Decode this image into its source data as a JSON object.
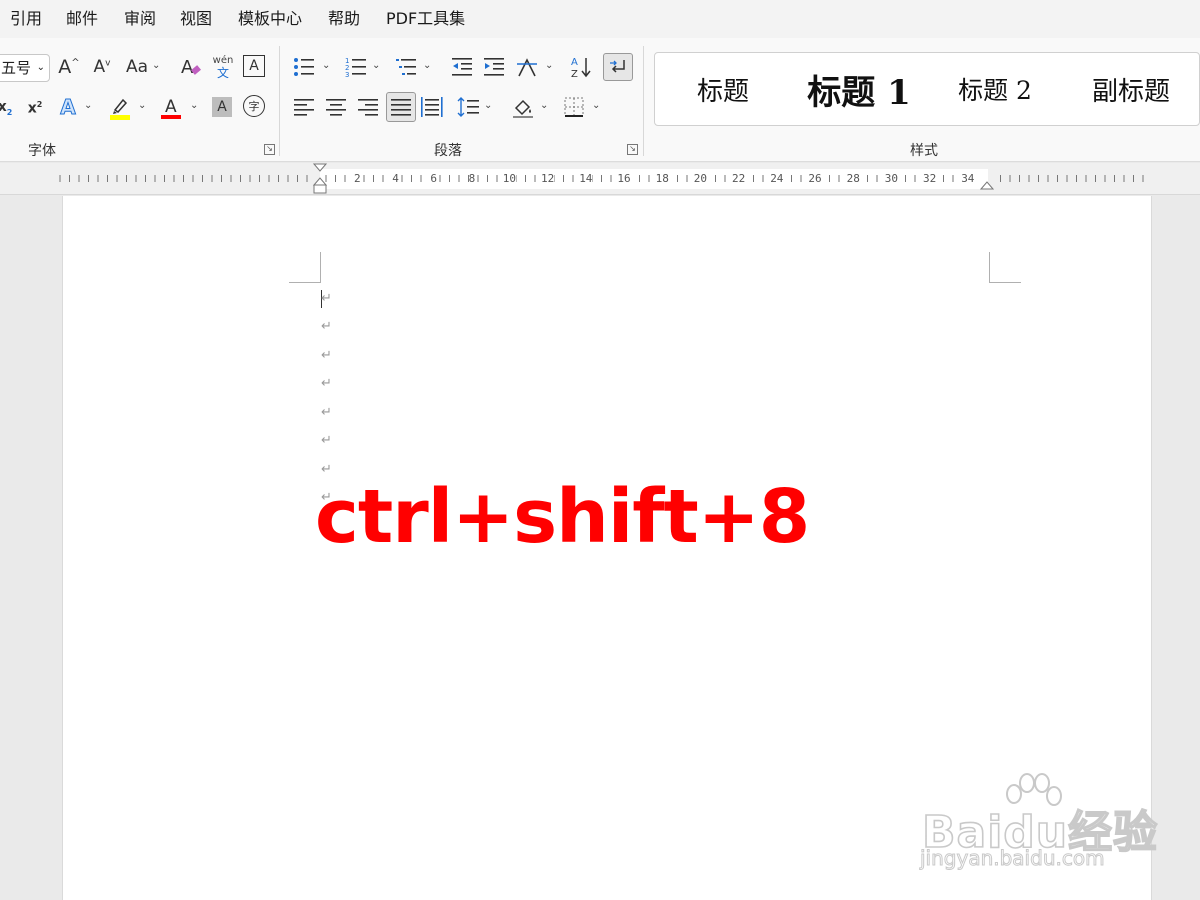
{
  "menu": [
    "引用",
    "邮件",
    "审阅",
    "视图",
    "模板中心",
    "帮助",
    "PDF工具集"
  ],
  "ribbon": {
    "font_group": {
      "label": "字体",
      "font_size": "五号",
      "phonetic_top": "wén",
      "phonetic_bottom": "文",
      "change_case": "Aa",
      "char_shading": "A",
      "enclose_char": "字",
      "grow_font": "A",
      "shrink_font": "A",
      "subscript": "x",
      "superscript": "x"
    },
    "paragraph_group": {
      "label": "段落"
    },
    "styles_group": {
      "label": "样式",
      "items": [
        "标题",
        "标题 1",
        "标题 2",
        "副标题"
      ]
    }
  },
  "ruler": {
    "numbers": [
      "2",
      "4",
      "6",
      "8",
      "10",
      "12",
      "14",
      "16",
      "18",
      "20",
      "22",
      "24",
      "26",
      "28",
      "30",
      "32",
      "34"
    ]
  },
  "document": {
    "paragraph_mark": "↵",
    "overlay_text": "ctrl+shift+8",
    "overlay_color": "#ff0000"
  },
  "watermark": {
    "logo_text": "Baidu经验",
    "url": "jingyan.baidu.com"
  },
  "colors": {
    "highlight": "#ffff00",
    "font_color": "#ff0000",
    "text_effect": "#1f6fd1"
  }
}
